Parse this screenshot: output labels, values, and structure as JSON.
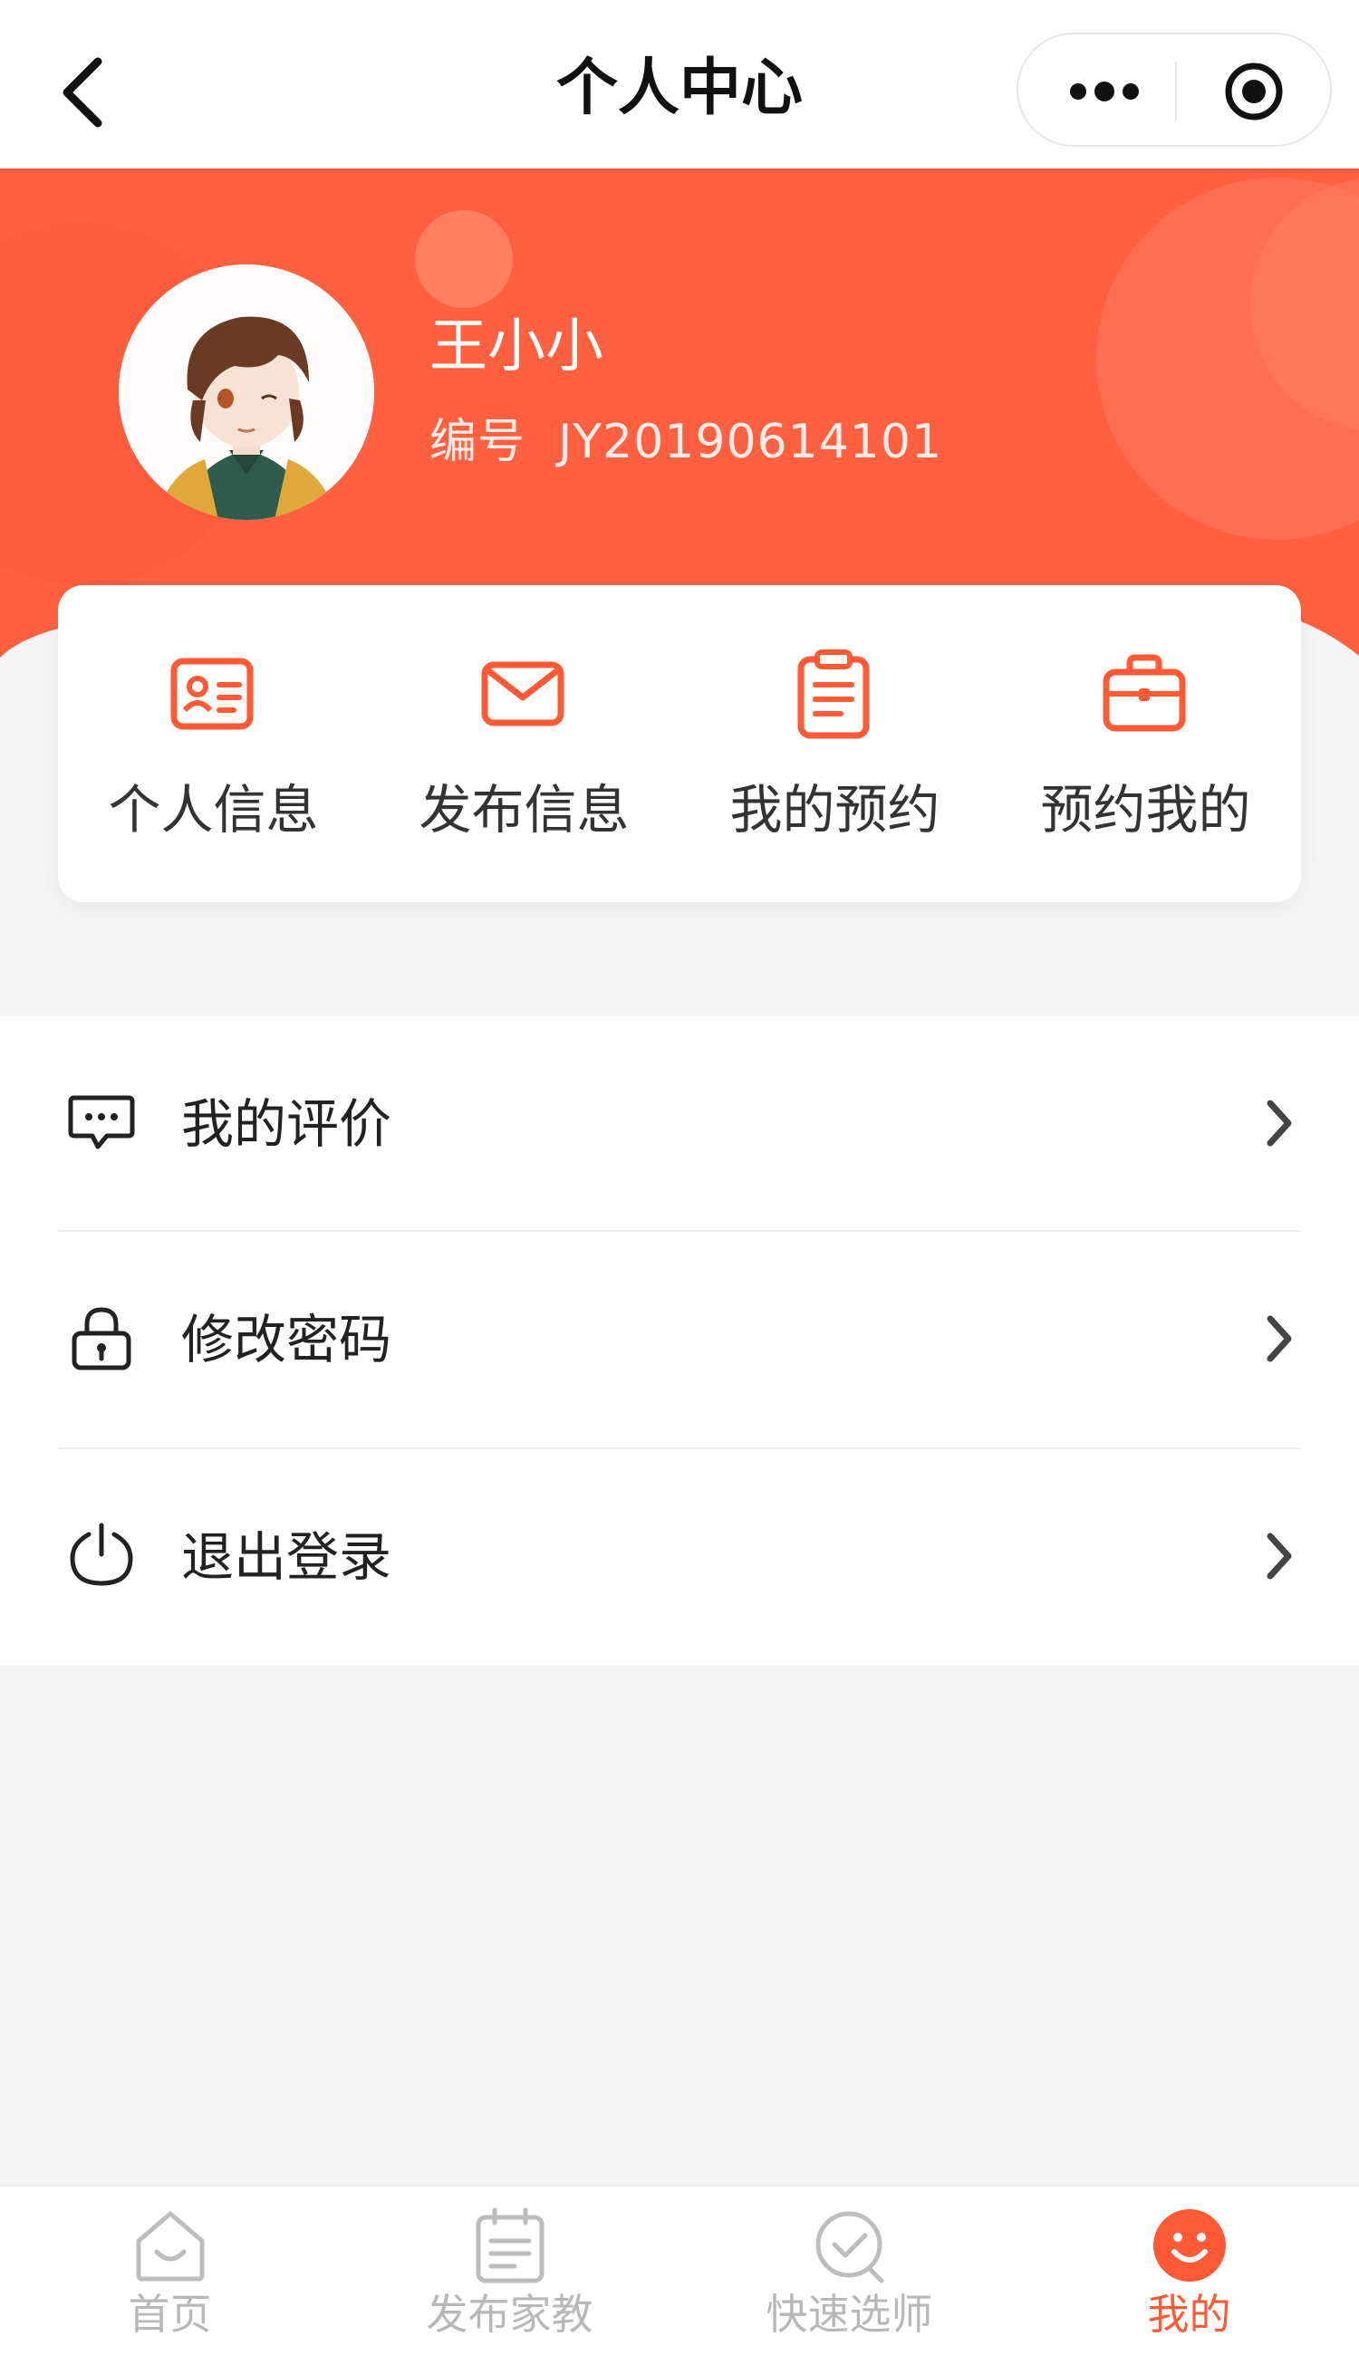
{
  "navbar": {
    "title": "个人中心"
  },
  "profile": {
    "name": "王小小",
    "id_label": "编号",
    "id_value": "JY20190614101"
  },
  "quick_actions": [
    {
      "label": "个人信息",
      "icon": "id-card-icon"
    },
    {
      "label": "发布信息",
      "icon": "envelope-icon"
    },
    {
      "label": "我的预约",
      "icon": "clipboard-icon"
    },
    {
      "label": "预约我的",
      "icon": "briefcase-icon"
    }
  ],
  "menu": [
    {
      "label": "我的评价",
      "icon": "chat-bubble-icon"
    },
    {
      "label": "修改密码",
      "icon": "lock-icon"
    },
    {
      "label": "退出登录",
      "icon": "power-icon"
    }
  ],
  "tabbar": [
    {
      "label": "首页",
      "icon": "home-icon",
      "active": false
    },
    {
      "label": "发布家教",
      "icon": "calendar-icon",
      "active": false
    },
    {
      "label": "快速选师",
      "icon": "check-circle-icon",
      "active": false
    },
    {
      "label": "我的",
      "icon": "smiley-icon",
      "active": true
    }
  ],
  "colors": {
    "accent": "#ff5a36",
    "banner": "#ff6140",
    "background": "#f5f5f5"
  }
}
